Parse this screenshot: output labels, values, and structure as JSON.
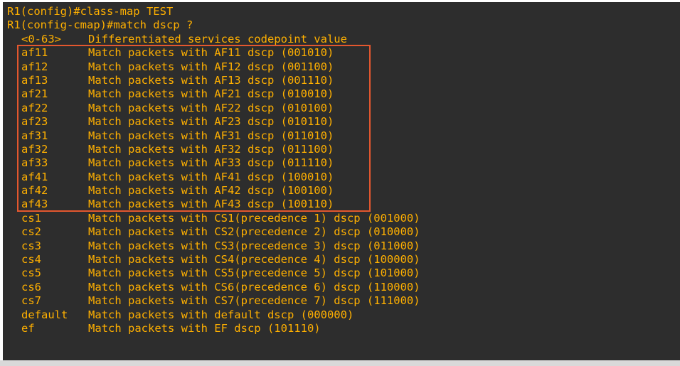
{
  "terminal": {
    "commands": [
      {
        "prompt": "R1(config)#",
        "input": "class-map TEST"
      },
      {
        "prompt": "R1(config-cmap)#",
        "input": "match dscp ?"
      }
    ],
    "rows": [
      {
        "option": "<0-63>",
        "description": "Differentiated services codepoint value"
      },
      {
        "option": "af11",
        "description": "Match packets with AF11 dscp (001010)"
      },
      {
        "option": "af12",
        "description": "Match packets with AF12 dscp (001100)"
      },
      {
        "option": "af13",
        "description": "Match packets with AF13 dscp (001110)"
      },
      {
        "option": "af21",
        "description": "Match packets with AF21 dscp (010010)"
      },
      {
        "option": "af22",
        "description": "Match packets with AF22 dscp (010100)"
      },
      {
        "option": "af23",
        "description": "Match packets with AF23 dscp (010110)"
      },
      {
        "option": "af31",
        "description": "Match packets with AF31 dscp (011010)"
      },
      {
        "option": "af32",
        "description": "Match packets with AF32 dscp (011100)"
      },
      {
        "option": "af33",
        "description": "Match packets with AF33 dscp (011110)"
      },
      {
        "option": "af41",
        "description": "Match packets with AF41 dscp (100010)"
      },
      {
        "option": "af42",
        "description": "Match packets with AF42 dscp (100100)"
      },
      {
        "option": "af43",
        "description": "Match packets with AF43 dscp (100110)"
      },
      {
        "option": "cs1",
        "description": "Match packets with CS1(precedence 1) dscp (001000)"
      },
      {
        "option": "cs2",
        "description": "Match packets with CS2(precedence 2) dscp (010000)"
      },
      {
        "option": "cs3",
        "description": "Match packets with CS3(precedence 3) dscp (011000)"
      },
      {
        "option": "cs4",
        "description": "Match packets with CS4(precedence 4) dscp (100000)"
      },
      {
        "option": "cs5",
        "description": "Match packets with CS5(precedence 5) dscp (101000)"
      },
      {
        "option": "cs6",
        "description": "Match packets with CS6(precedence 6) dscp (110000)"
      },
      {
        "option": "cs7",
        "description": "Match packets with CS7(precedence 7) dscp (111000)"
      },
      {
        "option": "default",
        "description": "Match packets with default dscp (000000)"
      },
      {
        "option": "ef",
        "description": "Match packets with EF dscp (101110)"
      }
    ]
  },
  "colors": {
    "background": "#2d2d2d",
    "text": "#ffb000",
    "highlight_border": "#e4572e"
  }
}
